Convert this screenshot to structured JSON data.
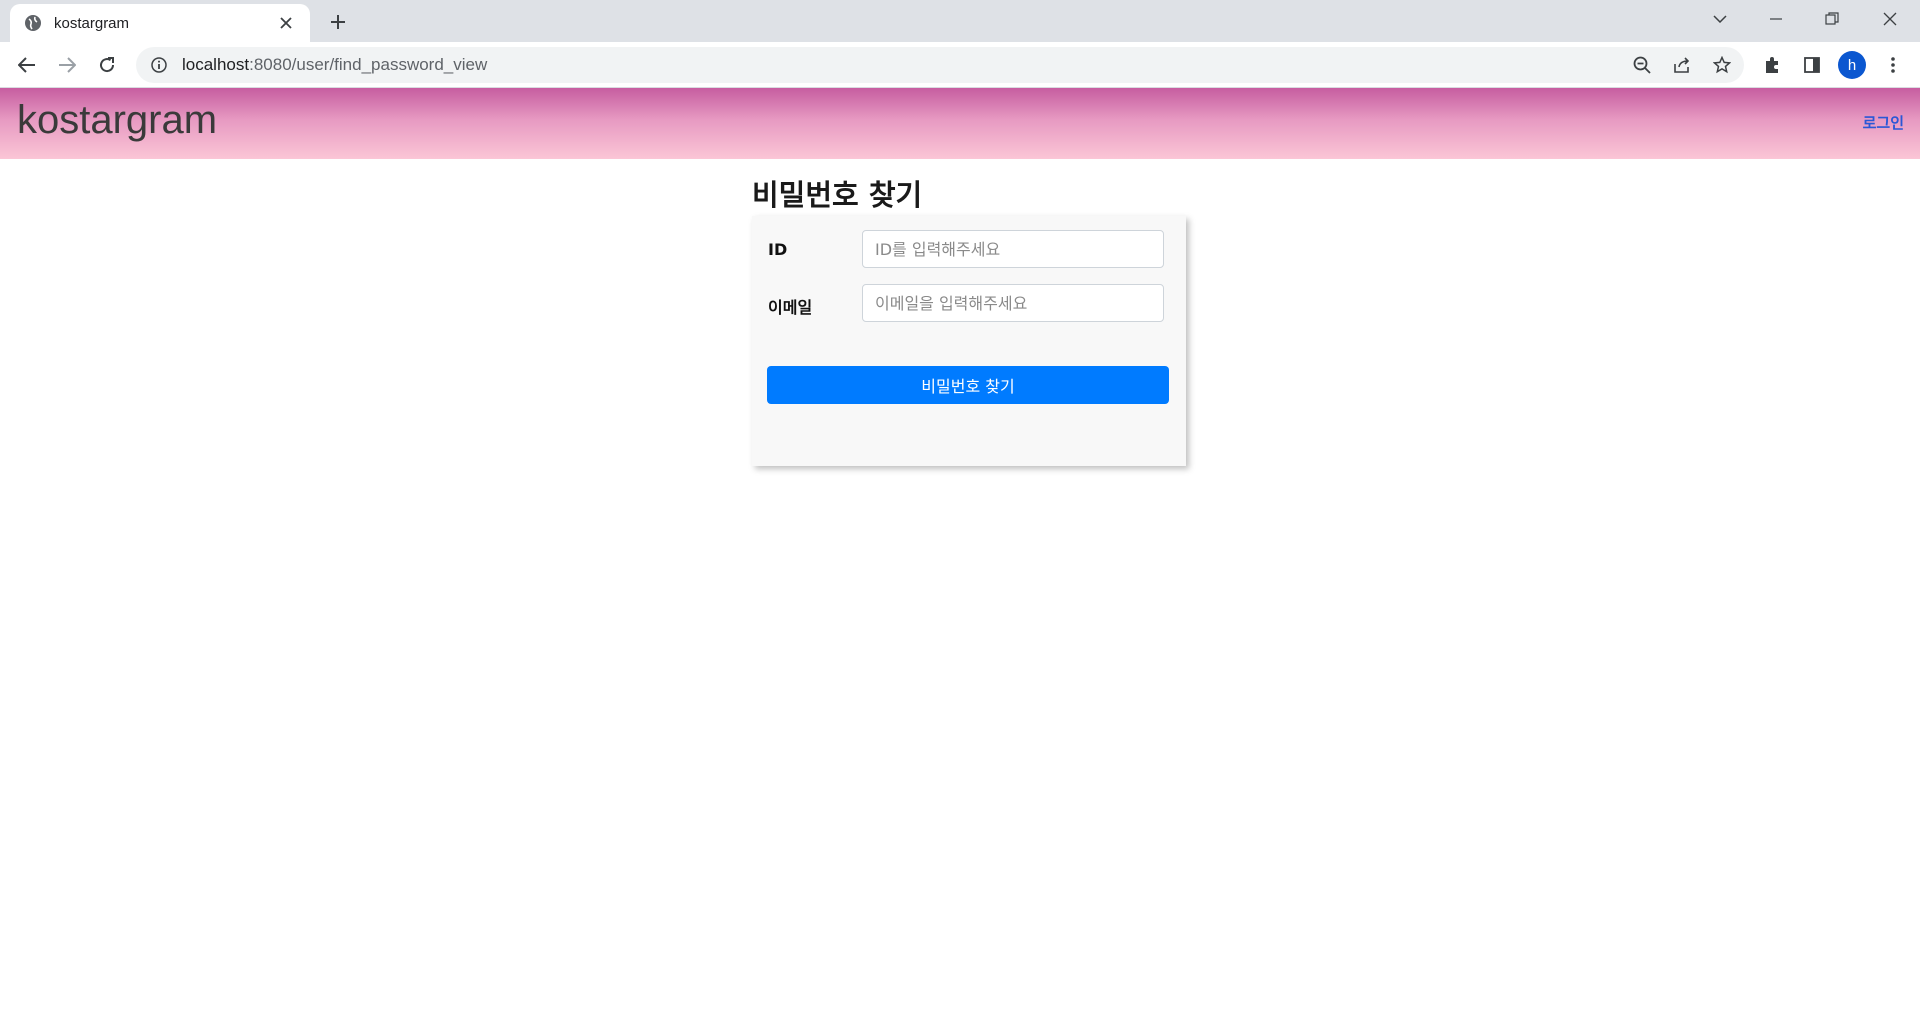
{
  "browser": {
    "tab_title": "kostargram",
    "url_host": "localhost",
    "url_path": ":8080/user/find_password_view",
    "avatar_letter": "h"
  },
  "site": {
    "brand": "kostargram",
    "login_link": "로그인",
    "header_gradient": [
      "#c65da0",
      "#fbc6d6"
    ]
  },
  "find_password": {
    "title": "비밀번호 찾기",
    "id_label": "ID",
    "id_placeholder": "ID를 입력해주세요",
    "email_label": "이메일",
    "email_placeholder": "이메일을 입력해주세요",
    "submit_label": "비밀번호 찾기",
    "submit_color": "#007bff"
  }
}
